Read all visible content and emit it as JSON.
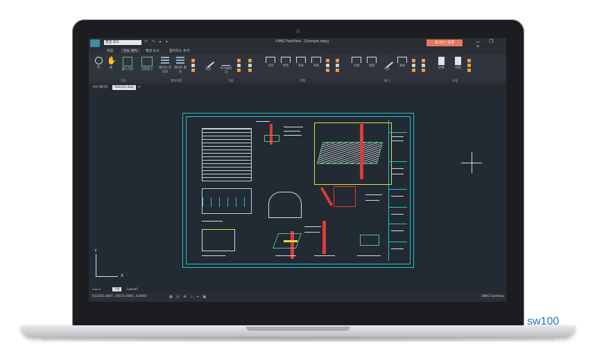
{
  "app": {
    "quick_access_value": "편집 모드",
    "document_title": "DWG FastView - [Sample.dwg]",
    "login_label": "로그인 / 등록",
    "window_buttons": "— ❐ ✕"
  },
  "menu": {
    "items": [
      "파일",
      "지도 제작",
      "확장 도구",
      "클라우드 주석"
    ],
    "active_index": 1
  },
  "ribbon": {
    "buttons": [
      {
        "label": "줌",
        "icon": "zoom-icon"
      },
      {
        "label": "팬",
        "icon": "pan-hand-icon"
      },
      {
        "label": "풀스크린",
        "icon": "fullscreen-icon"
      },
      {
        "label": "안말창구",
        "icon": "window-icon"
      },
      {
        "label": "레이어 관리자",
        "icon": "layer-manager-icon"
      },
      {
        "label": "레이어 활성",
        "icon": "layer-active-icon"
      },
      {
        "label": "직선",
        "icon": "line-icon"
      },
      {
        "label": "마크텔로지",
        "icon": "markup-icon"
      },
      {
        "label": "거리",
        "icon": "distance-icon"
      },
      {
        "label": "면적",
        "icon": "area-icon"
      },
      {
        "label": "좌표",
        "icon": "coordinate-icon"
      },
      {
        "label": "좌표",
        "icon": "coordinate2-icon"
      },
      {
        "label": "선형",
        "icon": "linear-dim-icon"
      },
      {
        "label": "정렬",
        "icon": "aligned-dim-icon"
      },
      {
        "label": "지도",
        "icon": "leader-icon"
      },
      {
        "label": "좌표",
        "icon": "dim-coordinate-icon"
      },
      {
        "label": "문채",
        "icon": "copy-icon"
      },
      {
        "label": "삭제",
        "icon": "delete-icon"
      }
    ],
    "groups": [
      "지도",
      "레이어로",
      "그림",
      "측정",
      "표기",
      "수정"
    ]
  },
  "doctabs": [
    "시작 페이지",
    "Sample.dwg"
  ],
  "layout_tabs": [
    "모델",
    "Layout1"
  ],
  "status": {
    "coordinates": "-453202.4487, 19570.5891, 0.0000",
    "brand": "DWG FastView"
  },
  "ucs": {
    "x": "X",
    "y": "Y"
  },
  "watermark": "sw100"
}
